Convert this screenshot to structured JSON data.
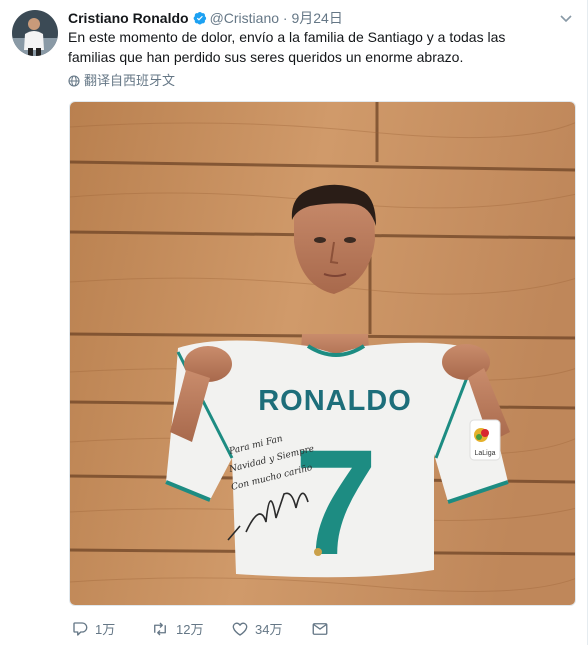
{
  "tweet": {
    "author": {
      "name": "Cristiano Ronaldo",
      "handle": "@Cristiano",
      "verified": true
    },
    "separator": "·",
    "date": "9月24日",
    "text": "En este momento de dolor, envío a la familia de Santiago y a todas las familias que han perdido sus seres queridos un enorme abrazo.",
    "translate_label": "翻译自西班牙文",
    "media": {
      "shirt_name": "RONALDO",
      "shirt_number": "7",
      "sleeve_badge": "LaLiga",
      "signature_lines": [
        "Para mi Fan",
        "Navidad y Siempre",
        "Con mucho cariño"
      ],
      "signature": "Cr7 RVilla"
    },
    "actions": {
      "reply_count": "1万",
      "retweet_count": "12万",
      "like_count": "34万"
    }
  },
  "colors": {
    "link_gray": "#657786",
    "verified_blue": "#1da1f2",
    "wood_light": "#c98e5e",
    "wood_dark": "#a86a3e",
    "teal": "#1d8c82"
  }
}
